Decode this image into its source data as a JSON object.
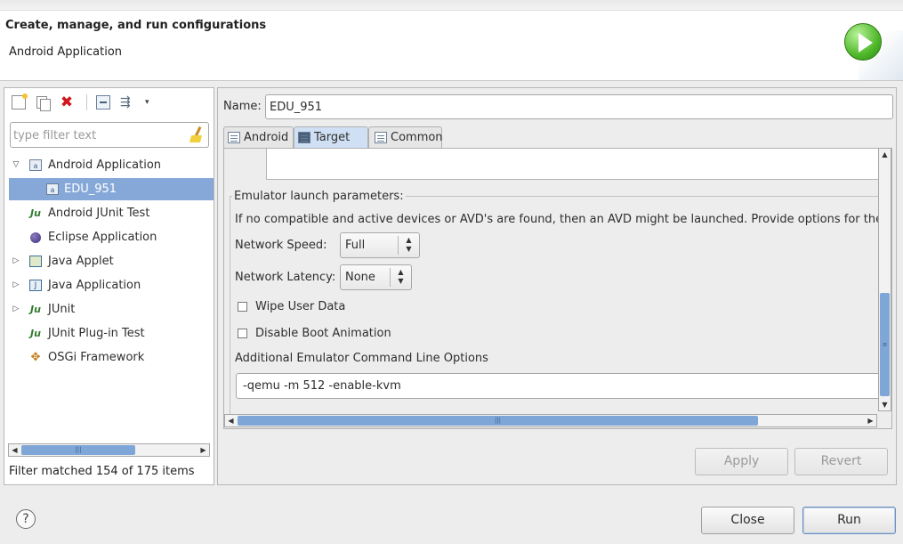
{
  "header": {
    "title": "Create, manage, and run configurations",
    "subtitle": "Android Application"
  },
  "sidebar": {
    "toolbar": [
      "new-configuration-icon",
      "duplicate-icon",
      "delete-icon",
      "collapse-all-icon",
      "filter-icon",
      "dropdown-icon"
    ],
    "filter_placeholder": "type filter text",
    "tree": [
      {
        "label": "Android Application",
        "expanded": true,
        "icon": "android-app-icon"
      },
      {
        "label": "EDU_951",
        "selected": true,
        "icon": "android-config-icon"
      },
      {
        "label": "Android JUnit Test",
        "icon": "junit-icon"
      },
      {
        "label": "Eclipse Application",
        "icon": "eclipse-icon"
      },
      {
        "label": "Java Applet",
        "expandable": true,
        "icon": "applet-icon"
      },
      {
        "label": "Java Application",
        "expandable": true,
        "icon": "java-app-icon"
      },
      {
        "label": "JUnit",
        "expandable": true,
        "icon": "junit-icon"
      },
      {
        "label": "JUnit Plug-in Test",
        "icon": "junit-plugin-icon"
      },
      {
        "label": "OSGi Framework",
        "icon": "osgi-icon"
      }
    ],
    "filter_status": "Filter matched 154 of 175 items"
  },
  "main": {
    "name_label": "Name:",
    "name_value": "EDU_951",
    "tabs": [
      {
        "label": "Android",
        "active": false
      },
      {
        "label": "Target",
        "active": true
      },
      {
        "label": "Common",
        "active": false
      }
    ],
    "emulator": {
      "group_title": "Emulator launch parameters:",
      "info": "If no compatible and active devices or AVD's are found, then an AVD might be launched. Provide options for the",
      "network_speed_label": "Network Speed:",
      "network_speed_value": "Full",
      "network_latency_label": "Network Latency:",
      "network_latency_value": "None",
      "wipe_label": "Wipe User Data",
      "wipe_checked": false,
      "boot_anim_label": "Disable Boot Animation",
      "boot_anim_checked": false,
      "cmd_label": "Additional Emulator Command Line Options",
      "cmd_value": "-qemu -m 512 -enable-kvm"
    },
    "apply_label": "Apply",
    "revert_label": "Revert"
  },
  "footer": {
    "close_label": "Close",
    "run_label": "Run"
  }
}
